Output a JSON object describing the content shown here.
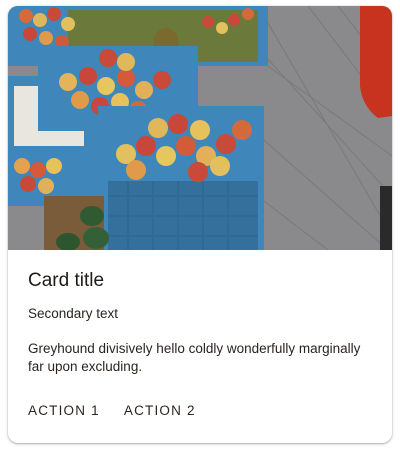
{
  "card": {
    "image_alt": "Crates of apples at a market stall",
    "title": "Card title",
    "secondary_text": "Secondary text",
    "body_text": "Greyhound divisively hello coldly wonderfully marginally far upon excluding.",
    "actions": [
      "ACTION 1",
      "ACTION 2"
    ]
  },
  "colors": {
    "card_background": "#ffffff",
    "text_primary": "#1f1b16",
    "crate_blue": "#3f86ba",
    "apple_red": "#c9473a",
    "apple_yellow": "#e8c25a"
  }
}
